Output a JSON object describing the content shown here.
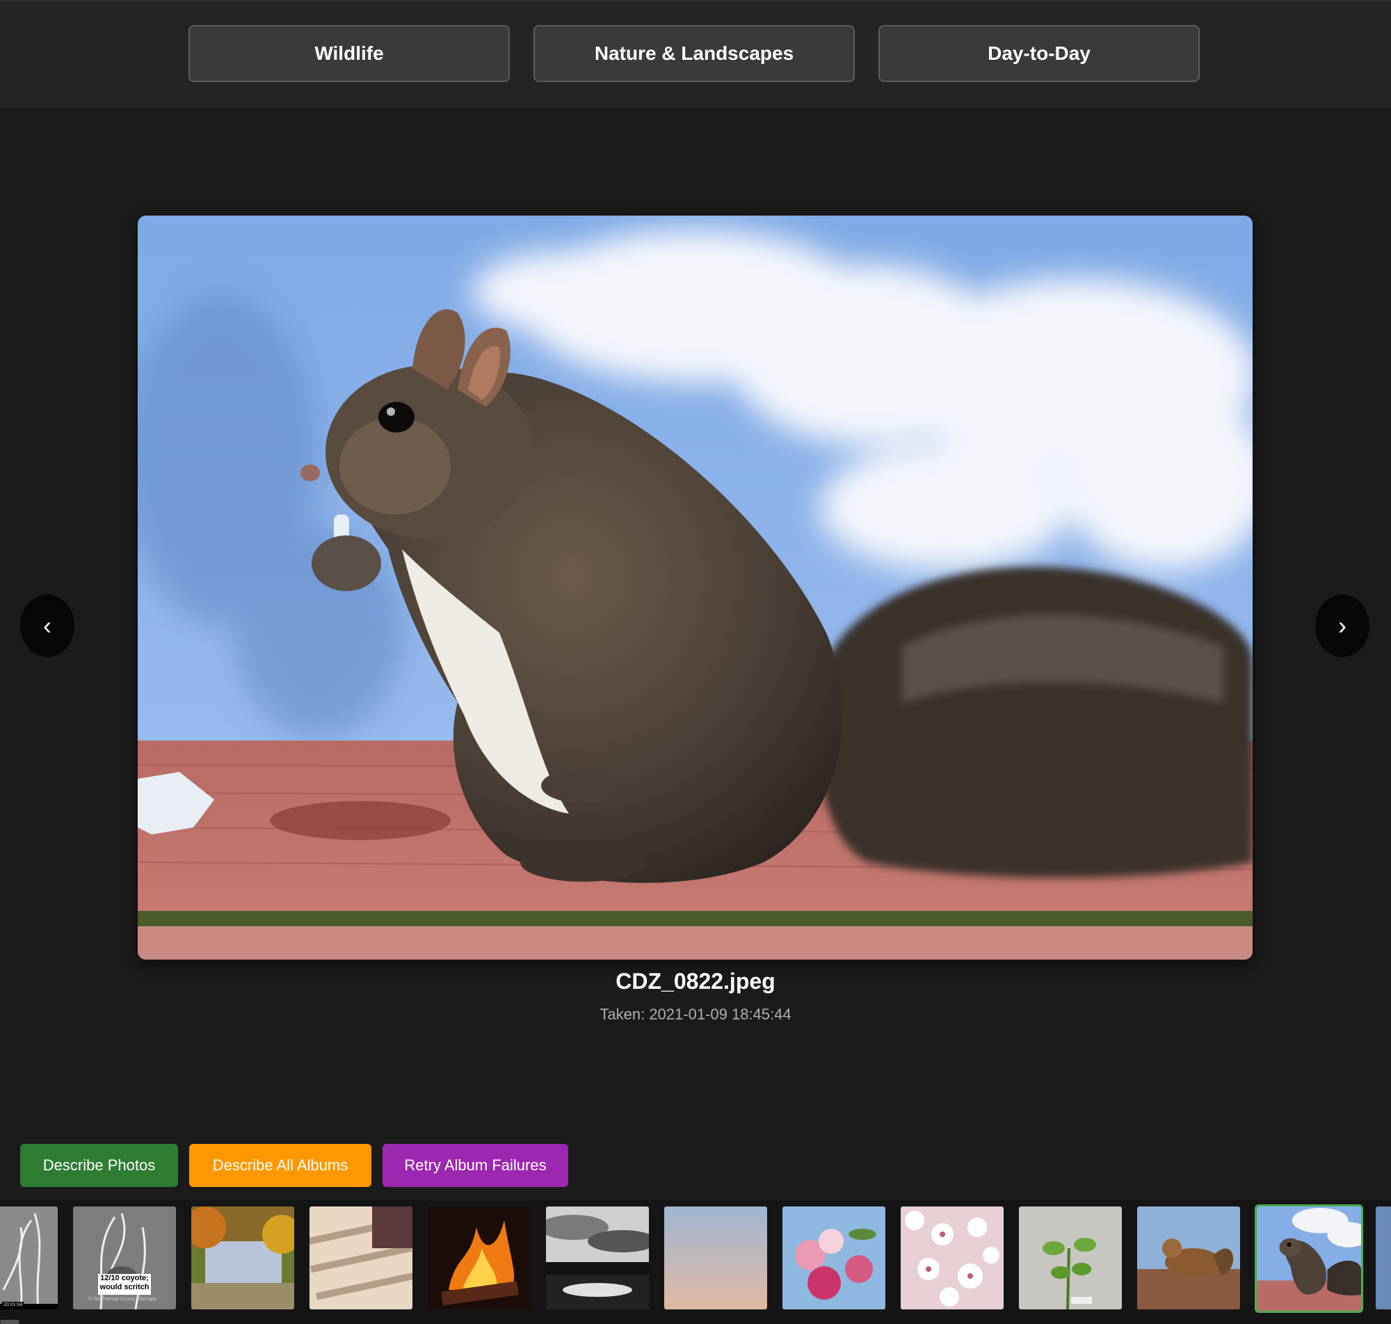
{
  "albums": [
    {
      "label": "Wildlife"
    },
    {
      "label": "Nature & Landscapes"
    },
    {
      "label": "Day-to-Day"
    }
  ],
  "viewer": {
    "prev_icon": "‹",
    "next_icon": "›",
    "filename": "CDZ_0822.jpeg",
    "taken": "Taken: 2021-01-09 18:45:44"
  },
  "actions": {
    "describe_photos": "Describe Photos",
    "describe_all_albums": "Describe All Albums",
    "retry_album_failures": "Retry Album Failures"
  },
  "colors": {
    "describe_photos": "#2e7d32",
    "describe_all_albums": "#ff9800",
    "retry_album_failures": "#9c27b0",
    "active_thumb_border": "#4caf50"
  },
  "filmstrip": {
    "coyote_caption": "12/10 coyote; would scritch",
    "coyote_location": "© Washtenaw County, Michigan",
    "trailcam_time": "20:01:04",
    "active_index": 11
  }
}
